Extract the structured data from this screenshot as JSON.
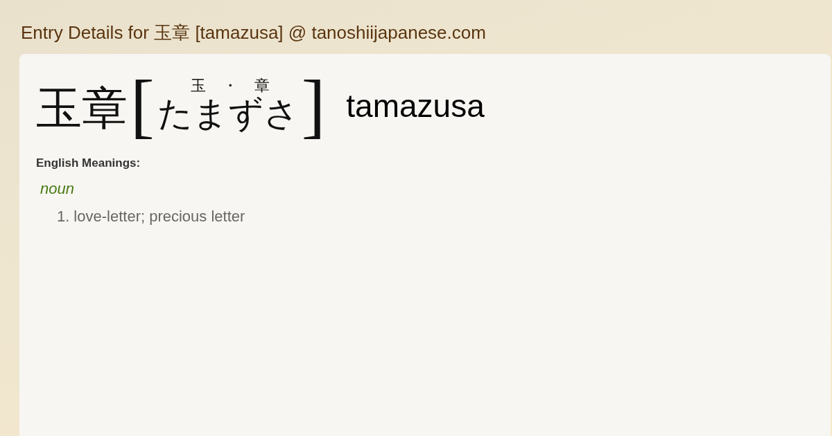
{
  "page_title": "Entry Details for 玉章 [tamazusa] @ tanoshiijapanese.com",
  "entry": {
    "word": "玉章",
    "bracket_open": "[",
    "bracket_close": "]",
    "furigana": [
      "玉",
      "・",
      "章"
    ],
    "reading": "たまずさ",
    "romaji": "tamazusa"
  },
  "meanings": {
    "heading": "English Meanings:",
    "part_of_speech": "noun",
    "items": [
      {
        "number": "1.",
        "text": "love-letter; precious letter"
      }
    ]
  }
}
